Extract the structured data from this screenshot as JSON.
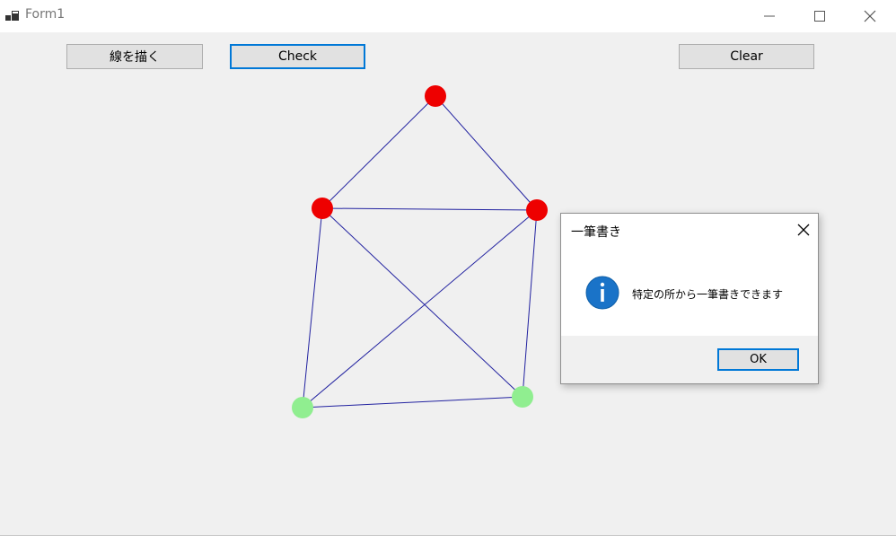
{
  "window": {
    "title": "Form1",
    "controls": {
      "minimize_icon": "minimize-icon",
      "maximize_icon": "maximize-icon",
      "close_icon": "close-icon"
    }
  },
  "toolbar": {
    "draw_label": "線を描く",
    "check_label": "Check",
    "clear_label": "Clear"
  },
  "graph": {
    "edge_color": "#2222a0",
    "nodes": [
      {
        "id": "top",
        "state": "odd",
        "color": "#ee0000"
      },
      {
        "id": "mid-left",
        "state": "odd",
        "color": "#ee0000"
      },
      {
        "id": "mid-right",
        "state": "odd",
        "color": "#ee0000"
      },
      {
        "id": "bottom-left",
        "state": "even",
        "color": "#90ee90"
      },
      {
        "id": "bottom-right",
        "state": "even",
        "color": "#90ee90"
      }
    ],
    "edges": [
      [
        "top",
        "mid-left"
      ],
      [
        "top",
        "mid-right"
      ],
      [
        "mid-left",
        "mid-right"
      ],
      [
        "mid-left",
        "bottom-left"
      ],
      [
        "mid-left",
        "bottom-right"
      ],
      [
        "mid-right",
        "bottom-left"
      ],
      [
        "mid-right",
        "bottom-right"
      ],
      [
        "bottom-left",
        "bottom-right"
      ]
    ]
  },
  "dialog": {
    "title": "一筆書き",
    "message": "特定の所から一筆書きできます",
    "icon": "info-icon",
    "ok_label": "OK"
  }
}
